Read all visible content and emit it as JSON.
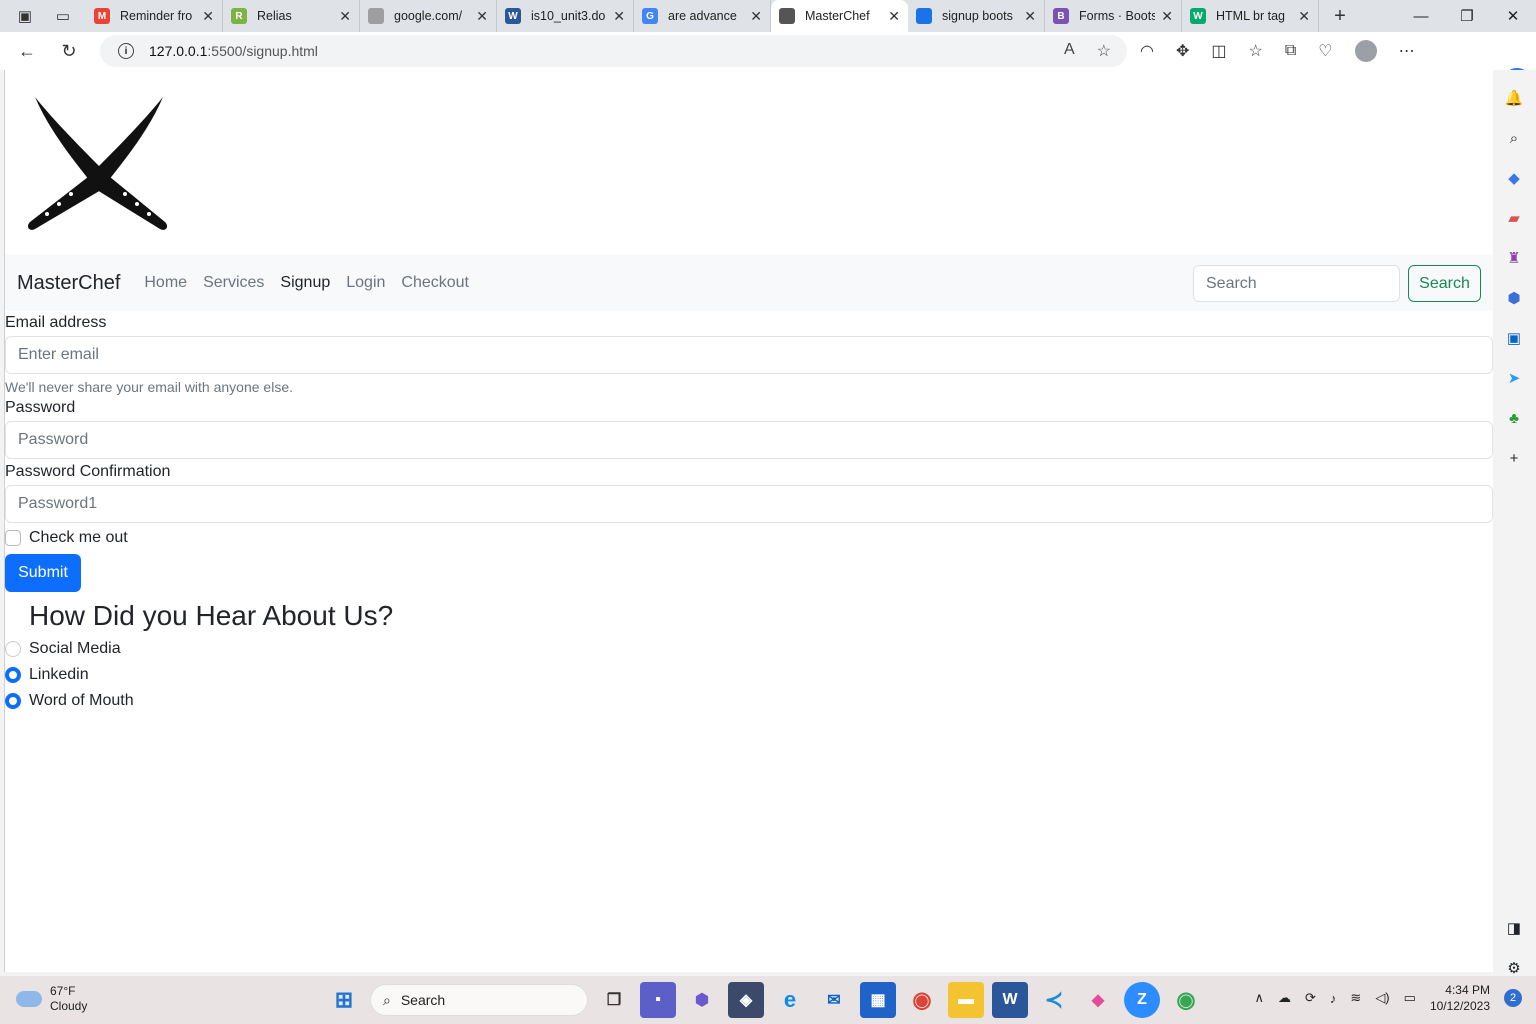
{
  "browser": {
    "tabs": [
      {
        "title": "Reminder fro",
        "fav": "M",
        "color": "#ea4335"
      },
      {
        "title": "Relias",
        "fav": "R",
        "color": "#7cb342"
      },
      {
        "title": "google.com/",
        "fav": "",
        "color": "#9e9e9e"
      },
      {
        "title": "is10_unit3.do",
        "fav": "W",
        "color": "#2b579a"
      },
      {
        "title": "are advance",
        "fav": "G",
        "color": "#4285f4"
      },
      {
        "title": "MasterChef",
        "fav": "",
        "color": "#555555",
        "active": true
      },
      {
        "title": "signup boots",
        "fav": "",
        "color": "#1a73e8"
      },
      {
        "title": "Forms · Boots",
        "fav": "B",
        "color": "#7952b3"
      },
      {
        "title": "HTML br tag",
        "fav": "W",
        "color": "#04aa6d"
      }
    ],
    "url_host": "127.0.0.1",
    "url_path": ":5500/signup.html"
  },
  "navbar": {
    "brand": "MasterChef",
    "links": [
      "Home",
      "Services",
      "Signup",
      "Login",
      "Checkout"
    ],
    "active_link": "Signup",
    "search_placeholder": "Search",
    "search_button": "Search"
  },
  "form": {
    "email_label": "Email address",
    "email_placeholder": "Enter email",
    "email_help": "We'll never share your email with anyone else.",
    "password_label": "Password",
    "password_placeholder": "Password",
    "confirm_label": "Password Confirmation",
    "confirm_placeholder": "Password1",
    "check_label": "Check me out",
    "submit_label": "Submit"
  },
  "survey": {
    "heading": "How Did you Hear About Us?",
    "options": [
      {
        "label": "Social Media",
        "checked": false
      },
      {
        "label": "Linkedin",
        "checked": true
      },
      {
        "label": "Word of Mouth",
        "checked": true
      }
    ]
  },
  "taskbar": {
    "temperature": "67°F",
    "condition": "Cloudy",
    "search": "Search",
    "time": "4:34 PM",
    "date": "10/12/2023",
    "notifications": "2"
  },
  "colors": {
    "primary": "#0d6efd",
    "success": "#198754"
  }
}
